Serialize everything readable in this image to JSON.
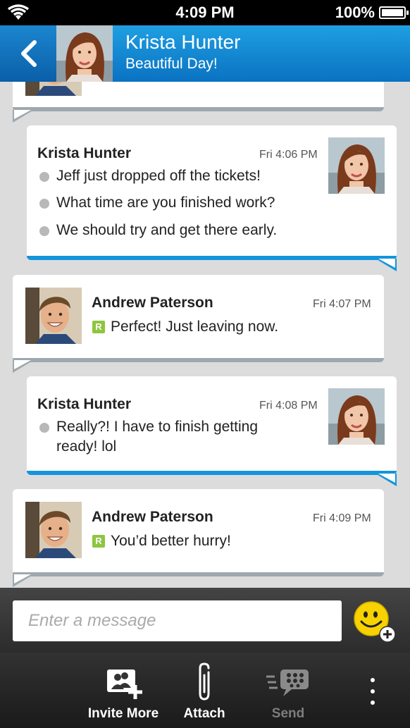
{
  "status_bar": {
    "time": "4:09 PM",
    "battery": "100%"
  },
  "header": {
    "contact_name": "Krista Hunter",
    "contact_status": "Beautiful Day!"
  },
  "messages": [
    {
      "sender": "Krista Hunter",
      "time": "Fri 4:06 PM",
      "lines": [
        "Jeff just dropped off the tickets!",
        "What time are you finished work?",
        "We should try and get there early."
      ]
    },
    {
      "sender": "Andrew Paterson",
      "time": "Fri 4:07 PM",
      "badge": "R",
      "text": "Perfect! Just leaving now."
    },
    {
      "sender": "Krista Hunter",
      "time": "Fri 4:08 PM",
      "lines": [
        "Really?! I have to finish getting",
        "ready! lol"
      ]
    },
    {
      "sender": "Andrew Paterson",
      "time": "Fri 4:09 PM",
      "badge": "R",
      "text": "You’d better hurry!"
    }
  ],
  "composer": {
    "placeholder": "Enter a message"
  },
  "toolbar": {
    "invite_label": "Invite More",
    "attach_label": "Attach",
    "send_label": "Send"
  },
  "colors": {
    "header_blue": "#0a72c2",
    "outgoing_accent": "#1395dd",
    "incoming_accent": "#9ea8ae",
    "r_badge": "#8dc63f"
  }
}
